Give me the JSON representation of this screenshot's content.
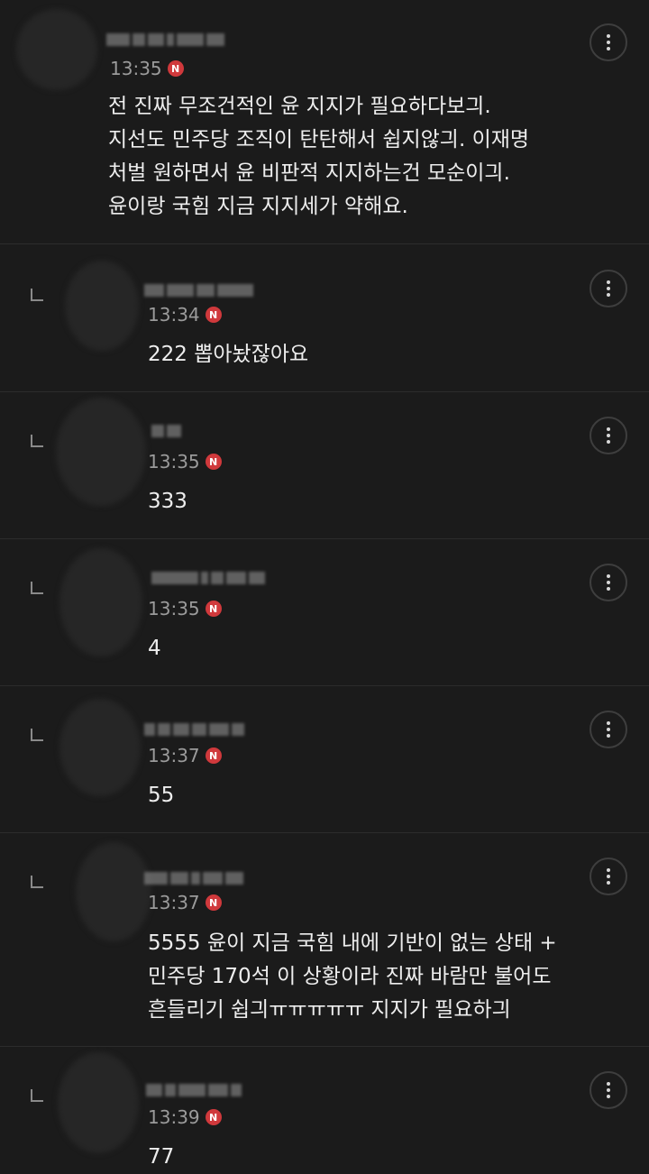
{
  "comments": [
    {
      "time": "13:35",
      "badge": "N",
      "text": "전 진짜 무조건적인 윤 지지가 필요하다보긔.\n지선도 민주당 조직이 탄탄해서 쉽지않긔. 이재명\n처벌 원하면서 윤 비판적 지지하는건 모순이긔.\n윤이랑 국힘 지금 지지세가 약해요."
    },
    {
      "time": "13:34",
      "badge": "N",
      "text": "222 뽑아놨잖아요"
    },
    {
      "time": "13:35",
      "badge": "N",
      "text": "333"
    },
    {
      "time": "13:35",
      "badge": "N",
      "text": "4"
    },
    {
      "time": "13:37",
      "badge": "N",
      "text": "55"
    },
    {
      "time": "13:37",
      "badge": "N",
      "text": "5555 윤이 지금 국힘 내에 기반이 없는 상태 +\n민주당 170석 이 상황이라 진짜 바람만 불어도\n흔들리기 쉽긔ㅠㅠㅠㅠㅠ 지지가 필요하긔"
    },
    {
      "time": "13:39",
      "badge": "N",
      "text": "77"
    }
  ]
}
